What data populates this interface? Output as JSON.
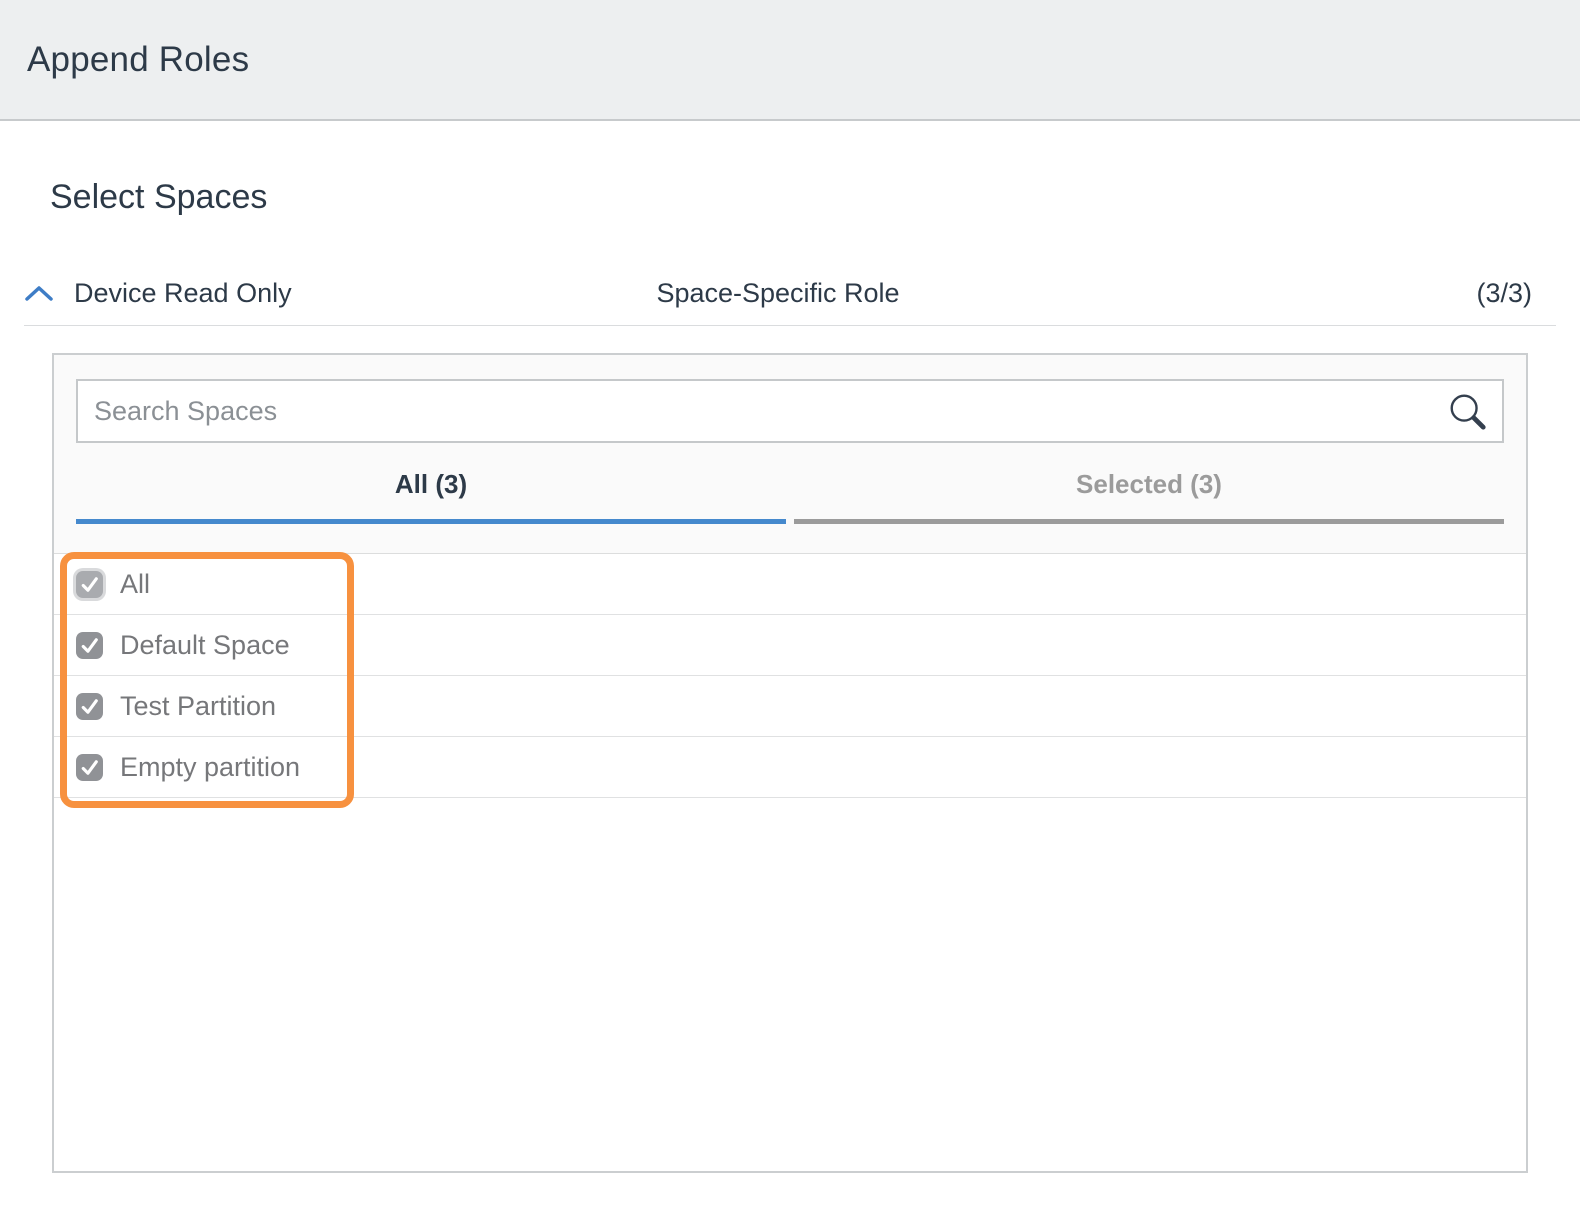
{
  "header": {
    "title": "Append Roles"
  },
  "section": {
    "title": "Select Spaces"
  },
  "role_row": {
    "role_name": "Device Read Only",
    "role_type": "Space-Specific Role",
    "count": "(3/3)",
    "collapse_icon": "chevron-up-icon"
  },
  "panel": {
    "search": {
      "placeholder": "Search Spaces",
      "icon": "search-icon",
      "value": ""
    },
    "tabs": [
      {
        "label": "All (3)",
        "active": true
      },
      {
        "label": "Selected (3)",
        "active": false
      }
    ],
    "spaces": [
      {
        "label": "All",
        "checked": true
      },
      {
        "label": "Default Space",
        "checked": true
      },
      {
        "label": "Test Partition",
        "checked": true
      },
      {
        "label": "Empty partition",
        "checked": true
      }
    ]
  },
  "colors": {
    "header_bg": "#edeff0",
    "dark_text": "#2d3a48",
    "accent_blue": "#4589cd",
    "chevron_blue": "#3e7dc6",
    "inactive_gray": "#9b9b9b",
    "checkbox_gray": "#909296",
    "highlight_orange": "#f7913f"
  }
}
